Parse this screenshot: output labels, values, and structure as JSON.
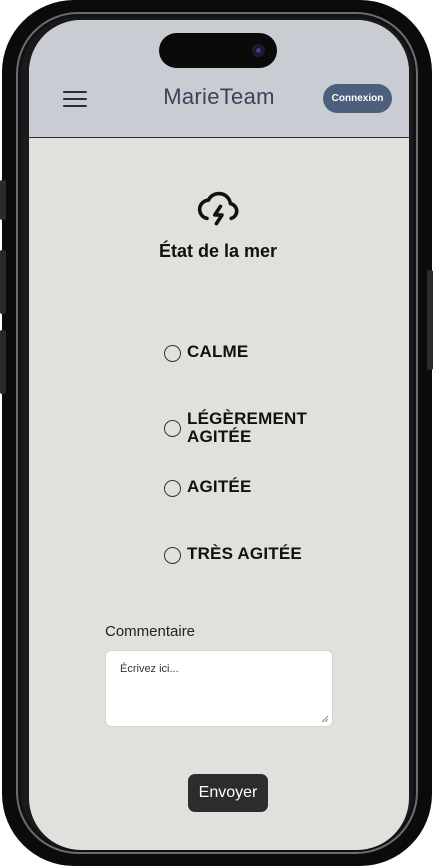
{
  "header": {
    "menu_icon": "hamburger-menu-icon",
    "brand": "MarieTeam",
    "login_label": "Connexion",
    "background": "#c9ccd3",
    "login_color": "#4c5f7c"
  },
  "sea_state": {
    "icon": "cloud-lightning-icon",
    "title": "État de la mer",
    "options": [
      {
        "label": "CALME",
        "selected": false
      },
      {
        "label": "LÉGÈREMENT AGITÉE",
        "selected": false
      },
      {
        "label": "AGITÉE",
        "selected": false
      },
      {
        "label": "TRÈS AGITÉE",
        "selected": false
      }
    ]
  },
  "comment": {
    "label": "Commentaire",
    "placeholder": "Écrivez ici..."
  },
  "submit": {
    "label": "Envoyer",
    "color": "#2c2c2c"
  }
}
